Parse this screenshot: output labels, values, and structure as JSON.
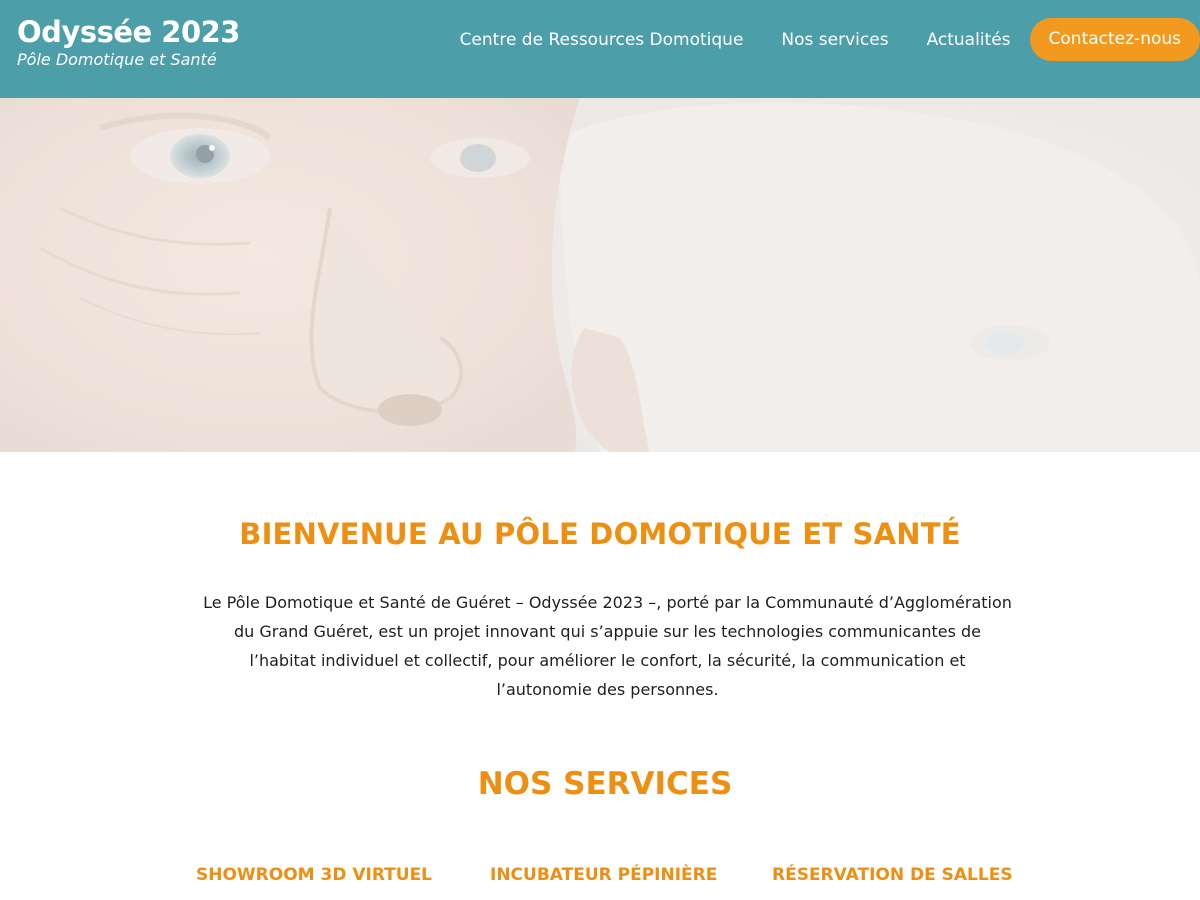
{
  "header": {
    "brand_title": "Odyssée 2023",
    "brand_subtitle": "Pôle Domotique et Santé",
    "nav": [
      {
        "label": "Centre de Ressources Domotique"
      },
      {
        "label": "Nos services"
      },
      {
        "label": "Actualités"
      }
    ],
    "cta_label": "Contactez-nous"
  },
  "main": {
    "welcome_title": "BIENVENUE AU PÔLE DOMOTIQUE ET SANTÉ",
    "welcome_text": "Le Pôle Domotique et Santé de Guéret – Odyssée 2023 –, porté par la Communauté d’Agglomération du Grand Guéret, est un projet innovant qui s’appuie sur les technologies communicantes de l’habitat individuel et collectif, pour améliorer le confort, la sécurité, la communication et l’autonomie des personnes.",
    "services_title": "NOS SERVICES",
    "services": [
      {
        "label": "SHOWROOM 3D VIRTUEL"
      },
      {
        "label": "INCUBATEUR PÉPINIÈRE"
      },
      {
        "label": "RÉSERVATION DE SALLES"
      }
    ]
  },
  "colors": {
    "header_bg": "#4c9fa9",
    "accent_orange": "#ee8f12",
    "cta_bg": "#f29a1f"
  }
}
